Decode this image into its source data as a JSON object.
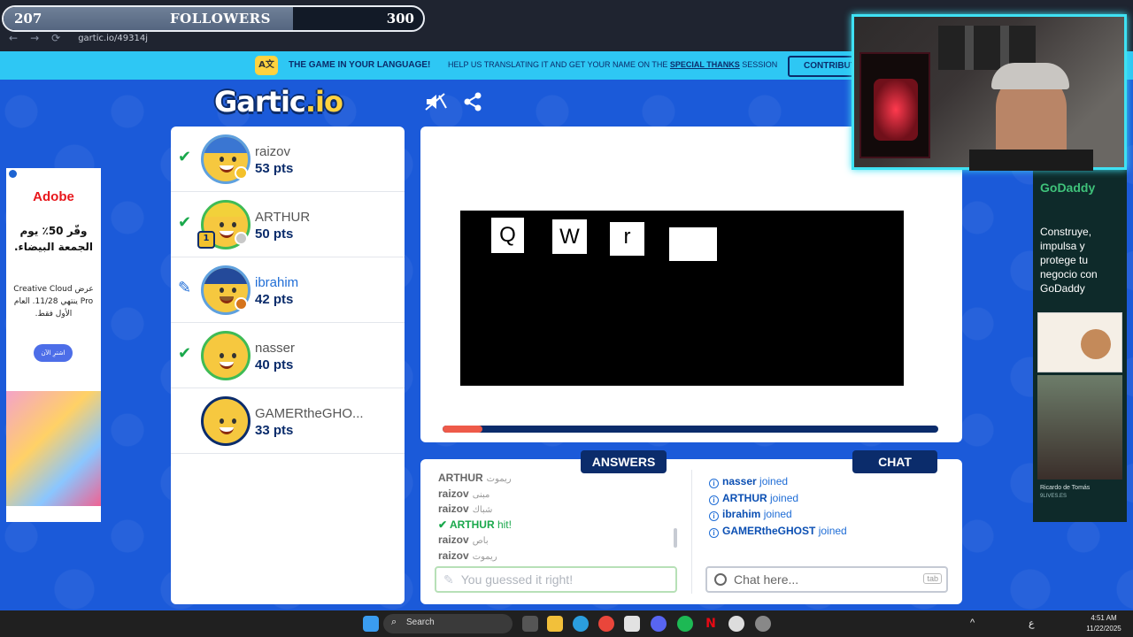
{
  "browser": {
    "url": "gartic.io/49314j",
    "back": "←",
    "forward": "→",
    "reload": "⟳"
  },
  "followers": {
    "current": "207",
    "label": "FOLLOWERS",
    "goal": "300",
    "progress_fraction": 0.69
  },
  "banner": {
    "title": "THE GAME IN YOUR LANGUAGE!",
    "text_before": "HELP US TRANSLATING IT AND GET YOUR NAME ON THE",
    "link": "SPECIAL THANKS",
    "text_after": "SESSION",
    "button": "CONTRIBUTE"
  },
  "logo": {
    "main": "Gartic",
    "suffix": ".io"
  },
  "players": [
    {
      "name": "raizov",
      "pts": "53 pts",
      "status": "hit",
      "badge_color": "#f4c12a"
    },
    {
      "name": "ARTHUR",
      "pts": "50 pts",
      "status": "hit",
      "badge_color": "#c8c8c8",
      "trophy": "1"
    },
    {
      "name": "ibrahim",
      "pts": "42 pts",
      "status": "drawing",
      "badge_color": "#d5741c"
    },
    {
      "name": "nasser",
      "pts": "40 pts",
      "status": "hit",
      "badge_color": ""
    },
    {
      "name": "GAMERtheGHO...",
      "pts": "33 pts",
      "status": "none",
      "badge_color": ""
    }
  ],
  "drawing": {
    "letters": [
      "Q",
      "W",
      "r",
      ""
    ],
    "timer_fraction": 0.08
  },
  "answers": {
    "tab": "ANSWERS",
    "items": [
      {
        "who": "ARTHUR",
        "what": "ريموت"
      },
      {
        "who": "raizov",
        "what": "مبنى"
      },
      {
        "who": "raizov",
        "what": "شباك"
      },
      {
        "who": "ARTHUR",
        "what": "hit!",
        "hit": true
      },
      {
        "who": "raizov",
        "what": "باص"
      },
      {
        "who": "raizov",
        "what": "ريموت"
      }
    ],
    "input_placeholder": "You guessed it right!"
  },
  "chat": {
    "tab": "CHAT",
    "items": [
      {
        "name": "nasser",
        "action": "joined"
      },
      {
        "name": "ARTHUR",
        "action": "joined"
      },
      {
        "name": "ibrahim",
        "action": "joined"
      },
      {
        "name": "GAMERtheGHOST",
        "action": "joined"
      }
    ],
    "input_placeholder": "Chat here...",
    "key_hint": "tab"
  },
  "ad_left": {
    "brand": "Adobe",
    "headline": "وفّر 50٪ يوم الجمعة البيضاء.",
    "body": "عرض Creative Cloud Pro ينتهي 11/28. العام الأول فقط.",
    "cta": "اشترِ الآن"
  },
  "ad_right": {
    "brand": "GoDaddy",
    "copy": "Construye, impulsa y protege tu negocio con GoDaddy",
    "credit": "Ricardo de Tomás",
    "credit2": "9LIVES.ES"
  },
  "taskbar": {
    "search": "Search",
    "time": "4:51 AM",
    "date": "11/22/2025",
    "lang": "ع"
  }
}
